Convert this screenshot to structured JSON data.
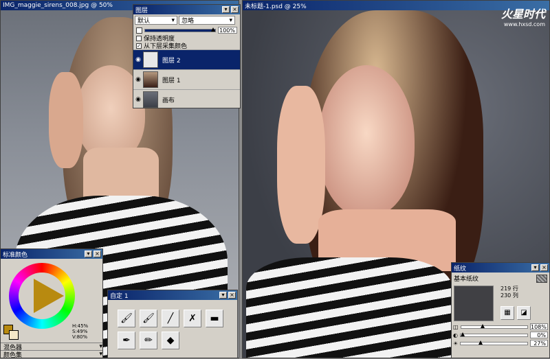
{
  "photo_window": {
    "title": "IMG_maggie_sirens_008.jpg @ 50%"
  },
  "painting_window": {
    "title": "未标题-1.psd @ 25%"
  },
  "watermark": {
    "brand": "火星时代",
    "url": "www.hxsd.com"
  },
  "layers_panel": {
    "title": "图层",
    "composite": "默认",
    "mode": "忽略",
    "opacity": "100%",
    "options": [
      {
        "label": "保持透明度",
        "checked": false
      },
      {
        "label": "从下层采集颜色",
        "checked": true
      }
    ],
    "layers": [
      {
        "name": "图层 2",
        "selected": true
      },
      {
        "name": "图层 1",
        "selected": false
      },
      {
        "name": "画布",
        "selected": false
      }
    ]
  },
  "color_panel": {
    "title": "标准颜色",
    "hsv": {
      "h": "H:45%",
      "s": "S:49%",
      "v": "V:80%"
    },
    "subpanels": [
      "混色器",
      "颜色集"
    ],
    "primary_color": "#b88a10",
    "secondary_color": "#f4e8c8"
  },
  "brush_panel": {
    "title": "自定  1",
    "brushes": [
      "brush-icon",
      "brush-icon",
      "brush-icon",
      "brush-icon",
      "brush-icon",
      "pen-icon",
      "pencil-icon",
      "knife-icon"
    ]
  },
  "paper_panel": {
    "title": "纸纹",
    "paper_name": "基本纸纹",
    "rows": "219 行",
    "cols": "230 列",
    "scale": "108%",
    "contrast": "0%",
    "brightness": "27%"
  }
}
